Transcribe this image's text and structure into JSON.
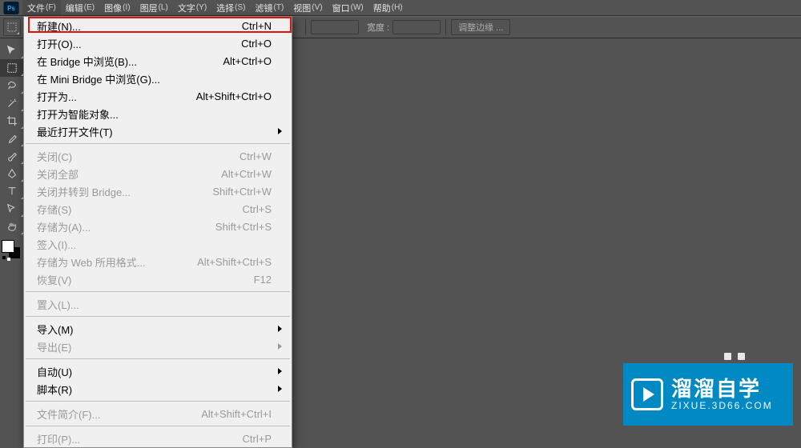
{
  "menubar": {
    "items": [
      {
        "label": "文件",
        "access": "(F)"
      },
      {
        "label": "编辑",
        "access": "(E)"
      },
      {
        "label": "图像",
        "access": "(I)"
      },
      {
        "label": "图层",
        "access": "(L)"
      },
      {
        "label": "文字",
        "access": "(Y)"
      },
      {
        "label": "选择",
        "access": "(S)"
      },
      {
        "label": "滤镜",
        "access": "(T)"
      },
      {
        "label": "视图",
        "access": "(V)"
      },
      {
        "label": "窗口",
        "access": "(W)"
      },
      {
        "label": "帮助",
        "access": "(H)"
      }
    ]
  },
  "optionbar": {
    "width_label": "宽度 :",
    "adjust_edge": "调整边缘 ..."
  },
  "dropdown": {
    "items": [
      {
        "label": "新建(N)...",
        "shortcut": "Ctrl+N",
        "disabled": false
      },
      {
        "label": "打开(O)...",
        "shortcut": "Ctrl+O",
        "disabled": false
      },
      {
        "label": "在 Bridge 中浏览(B)...",
        "shortcut": "Alt+Ctrl+O",
        "disabled": false
      },
      {
        "label": "在 Mini Bridge 中浏览(G)...",
        "shortcut": "",
        "disabled": false
      },
      {
        "label": "打开为...",
        "shortcut": "Alt+Shift+Ctrl+O",
        "disabled": false
      },
      {
        "label": "打开为智能对象...",
        "shortcut": "",
        "disabled": false
      },
      {
        "label": "最近打开文件(T)",
        "shortcut": "",
        "disabled": false,
        "submenu": true
      },
      {
        "sep": true
      },
      {
        "label": "关闭(C)",
        "shortcut": "Ctrl+W",
        "disabled": true
      },
      {
        "label": "关闭全部",
        "shortcut": "Alt+Ctrl+W",
        "disabled": true
      },
      {
        "label": "关闭并转到 Bridge...",
        "shortcut": "Shift+Ctrl+W",
        "disabled": true
      },
      {
        "label": "存储(S)",
        "shortcut": "Ctrl+S",
        "disabled": true
      },
      {
        "label": "存储为(A)...",
        "shortcut": "Shift+Ctrl+S",
        "disabled": true
      },
      {
        "label": "签入(I)...",
        "shortcut": "",
        "disabled": true
      },
      {
        "label": "存储为 Web 所用格式...",
        "shortcut": "Alt+Shift+Ctrl+S",
        "disabled": true
      },
      {
        "label": "恢复(V)",
        "shortcut": "F12",
        "disabled": true
      },
      {
        "sep": true
      },
      {
        "label": "置入(L)...",
        "shortcut": "",
        "disabled": true
      },
      {
        "sep": true
      },
      {
        "label": "导入(M)",
        "shortcut": "",
        "disabled": false,
        "submenu": true
      },
      {
        "label": "导出(E)",
        "shortcut": "",
        "disabled": true,
        "submenu": true
      },
      {
        "sep": true
      },
      {
        "label": "自动(U)",
        "shortcut": "",
        "disabled": false,
        "submenu": true
      },
      {
        "label": "脚本(R)",
        "shortcut": "",
        "disabled": false,
        "submenu": true
      },
      {
        "sep": true
      },
      {
        "label": "文件简介(F)...",
        "shortcut": "Alt+Shift+Ctrl+I",
        "disabled": true
      },
      {
        "sep": true
      },
      {
        "label": "打印(P)...",
        "shortcut": "Ctrl+P",
        "disabled": true
      }
    ]
  },
  "watermark": {
    "text": "溜溜自学",
    "url": "ZIXUE.3D66.COM"
  },
  "tools": [
    "move",
    "marquee",
    "lasso",
    "wand",
    "crop",
    "eyedropper",
    "healing",
    "brush",
    "stamp",
    "history",
    "eraser",
    "gradient",
    "blur",
    "dodge",
    "pen",
    "type",
    "path",
    "rect",
    "hand",
    "zoom"
  ]
}
